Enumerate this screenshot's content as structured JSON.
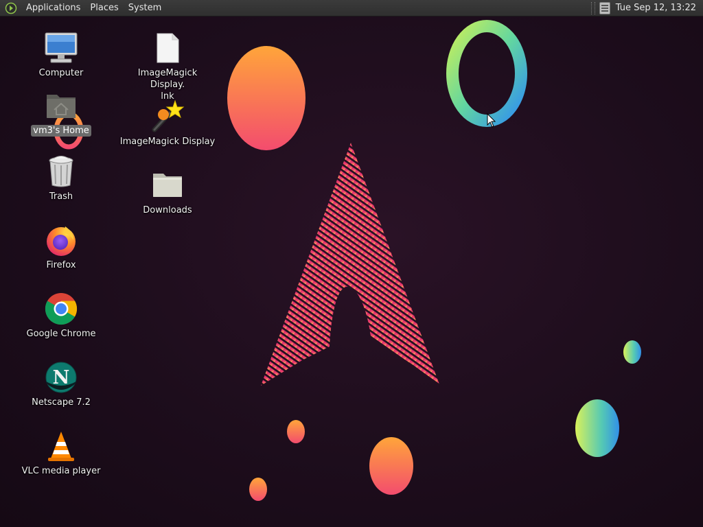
{
  "panel": {
    "menus": [
      "Applications",
      "Places",
      "System"
    ],
    "clock": "Tue Sep 12, 13:22"
  },
  "desktop": {
    "icons": [
      {
        "label": "Computer",
        "icon": "computer-icon"
      },
      {
        "label": "vm3's Home",
        "icon": "home-folder-icon"
      },
      {
        "label": "Trash",
        "icon": "trash-icon"
      },
      {
        "label": "Firefox",
        "icon": "firefox-icon"
      },
      {
        "label": "Google Chrome",
        "icon": "chrome-icon"
      },
      {
        "label": "Netscape 7.2",
        "icon": "netscape-icon"
      },
      {
        "label": "VLC media player",
        "icon": "vlc-icon"
      },
      {
        "label": "ImageMagick Display.\nlnk",
        "icon": "file-icon"
      },
      {
        "label": "ImageMagick Display",
        "icon": "imagemagick-icon"
      },
      {
        "label": "Downloads",
        "icon": "folder-icon"
      }
    ]
  },
  "colors": {
    "panel_bg": "#333333",
    "desktop_bg": "#1d0d1c",
    "accent_pink": "#e0266f",
    "accent_orange": "#ff9a3c"
  }
}
